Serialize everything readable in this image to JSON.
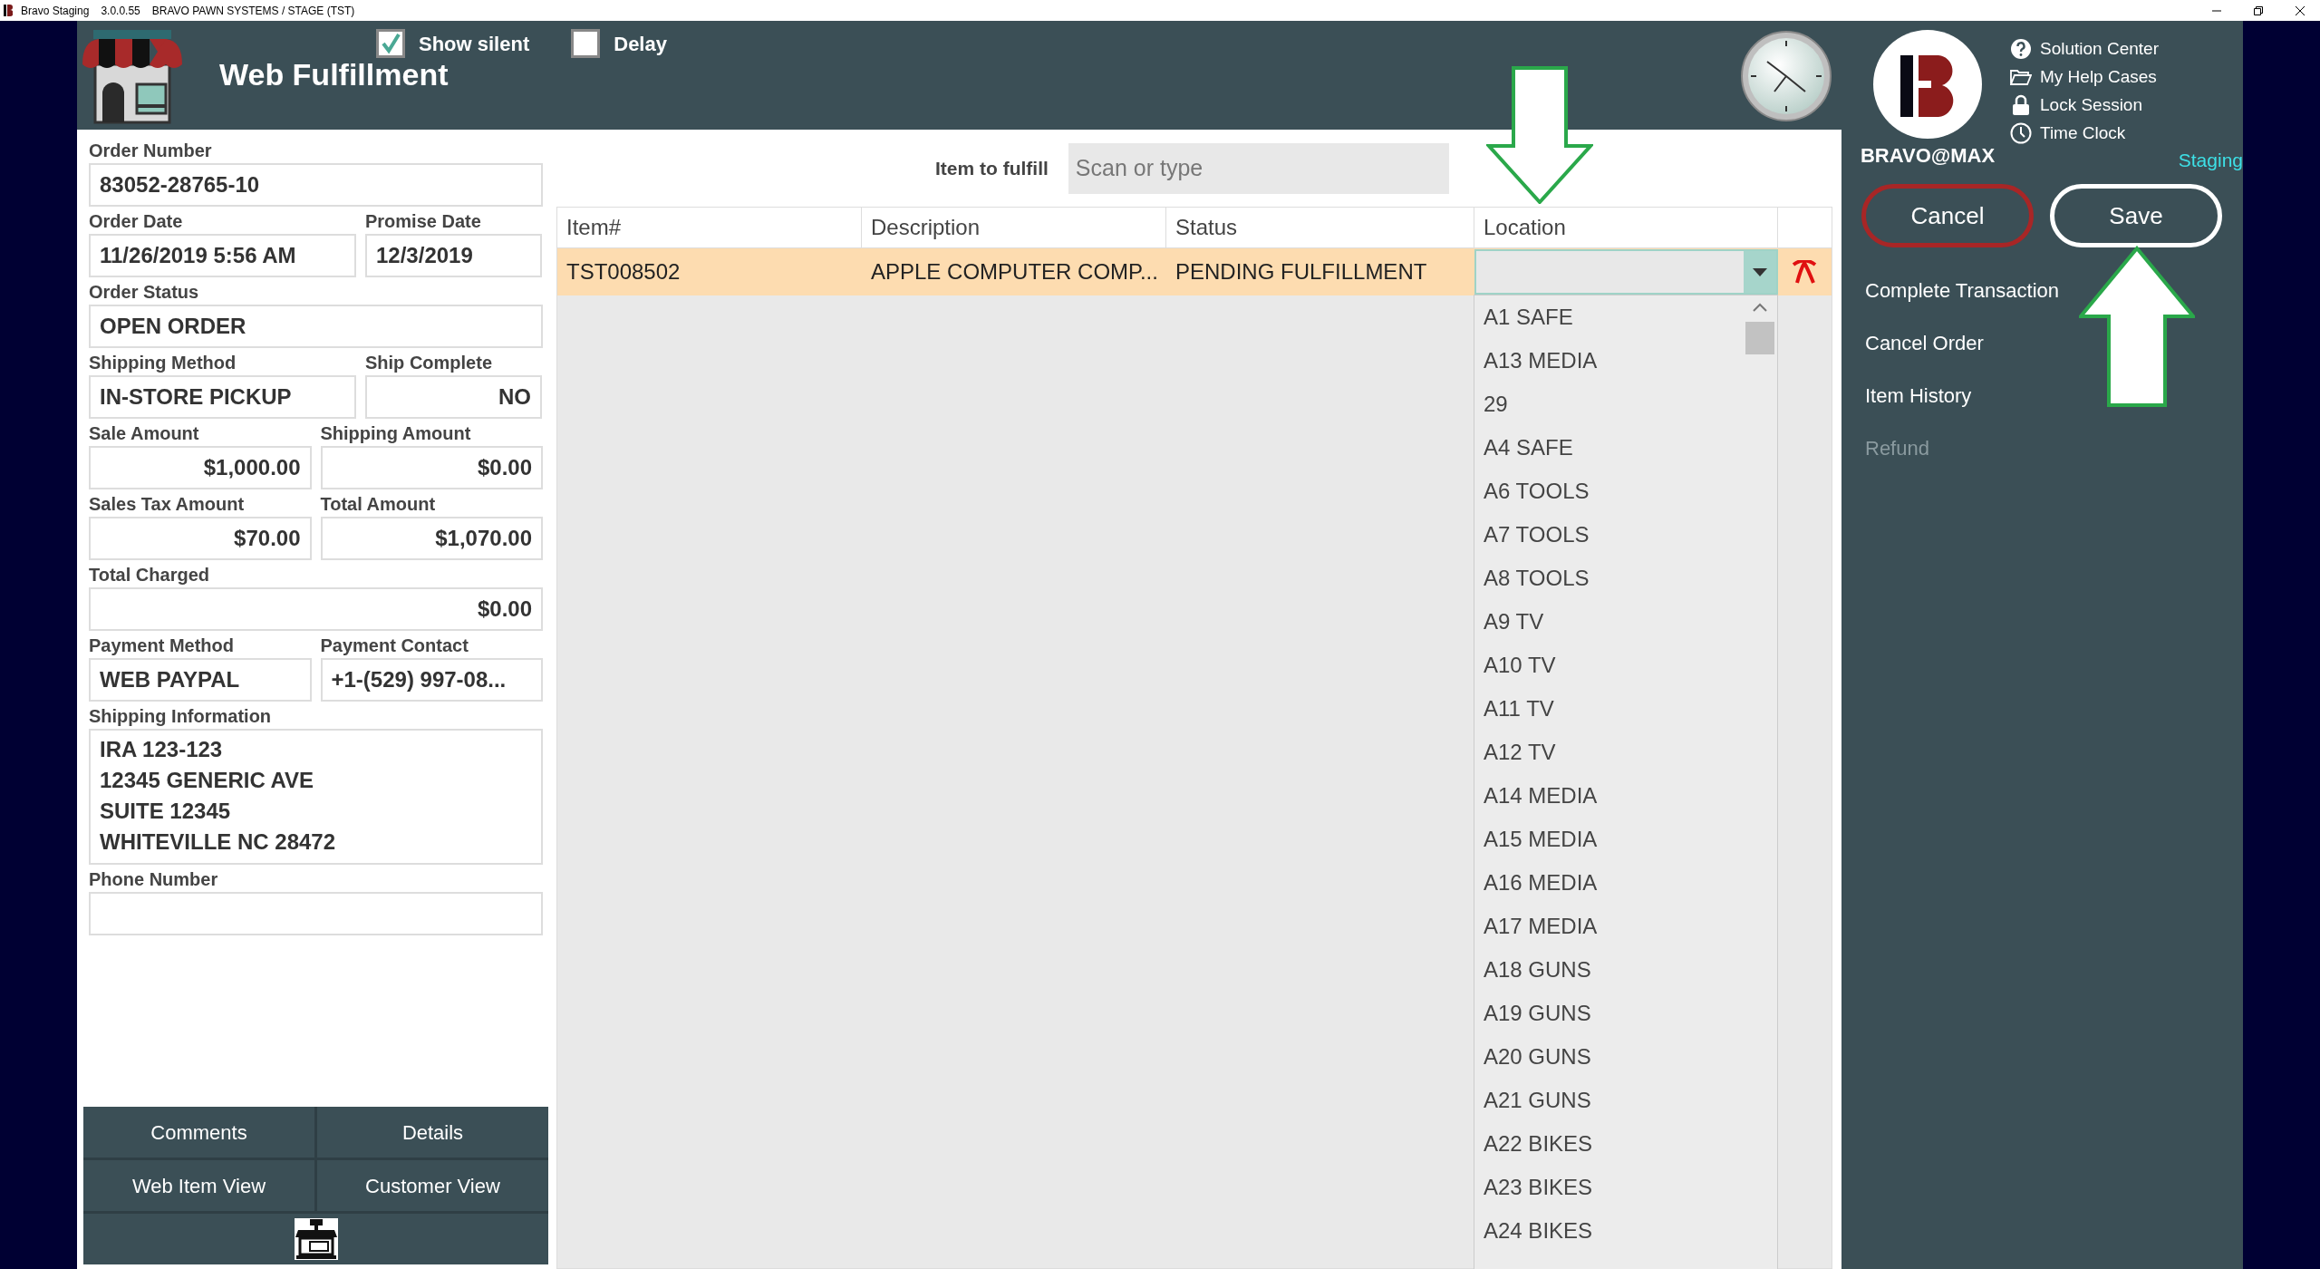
{
  "title_bar": {
    "app_name": "Bravo Staging",
    "version": "3.0.0.55",
    "system": "BRAVO PAWN SYSTEMS / STAGE (TST)"
  },
  "header": {
    "title": "Web Fulfillment",
    "options": [
      {
        "label": "Show silent",
        "checked": true
      },
      {
        "label": "Delay",
        "checked": false
      }
    ]
  },
  "order_form": {
    "rows": [
      [
        {
          "label": "Order Number",
          "value": "83052-28765-10",
          "kind": "text"
        }
      ],
      [
        {
          "label": "Order Date",
          "value": "11/26/2019 5:56 AM",
          "kind": "text"
        },
        {
          "label": "Promise Date",
          "value": "12/3/2019",
          "kind": "text"
        }
      ],
      [
        {
          "label": "Order Status",
          "value": "OPEN ORDER",
          "kind": "text"
        }
      ],
      [
        {
          "label": "Shipping Method",
          "value": "IN-STORE PICKUP",
          "kind": "text"
        },
        {
          "label": "Ship Complete",
          "value": "NO",
          "kind": "number"
        }
      ],
      [
        {
          "label": "Sale Amount",
          "value": "$1,000.00",
          "kind": "number"
        },
        {
          "label": "Shipping Amount",
          "value": "$0.00",
          "kind": "number"
        }
      ],
      [
        {
          "label": "Sales Tax Amount",
          "value": "$70.00",
          "kind": "number"
        },
        {
          "label": "Total Amount",
          "value": "$1,070.00",
          "kind": "number"
        }
      ],
      [
        {
          "label": "Total Charged",
          "value": "$0.00",
          "kind": "number"
        }
      ],
      [
        {
          "label": "Payment Method",
          "value": "WEB PAYPAL",
          "kind": "text"
        },
        {
          "label": "Payment Contact",
          "value": "+1-(529) 997-08...",
          "kind": "text"
        }
      ],
      [
        {
          "label": "Shipping Information",
          "lines": [
            "IRA 123-123",
            "12345 GENERIC AVE",
            "SUITE 12345",
            "WHITEVILLE NC 28472"
          ],
          "kind": "multiline"
        }
      ],
      [
        {
          "label": "Phone Number",
          "kind": "text"
        }
      ]
    ]
  },
  "bottom_buttons": [
    "Comments",
    "Details",
    "Web Item View",
    "Customer View"
  ],
  "item_to_fulfill": {
    "label": "Item to fulfill",
    "placeholder": "Scan or type"
  },
  "table": {
    "columns": [
      "Item#",
      "Description",
      "Status",
      "Location"
    ],
    "rows": [
      {
        "cells": [
          "TST008502",
          "APPLE COMPUTER COMP...",
          "PENDING FULFILLMENT"
        ],
        "selected": true
      }
    ]
  },
  "location_dropdown": {
    "expanded": true,
    "options": [
      "A1 SAFE",
      "A13 MEDIA",
      "29",
      "A4 SAFE",
      "A6 TOOLS",
      "A7 TOOLS",
      "A8 TOOLS",
      "A9 TV",
      "A10 TV",
      "A11 TV",
      "A12 TV",
      "A14 MEDIA",
      "A15 MEDIA",
      "A16 MEDIA",
      "A17 MEDIA",
      "A18 GUNS",
      "A19 GUNS",
      "A20 GUNS",
      "A21 GUNS",
      "A22 BIKES",
      "A23 BIKES",
      "A24 BIKES"
    ]
  },
  "right_panel": {
    "brand": "BRAVO@MAX",
    "environment": "Staging",
    "help_links": [
      {
        "label": "Solution Center",
        "kind": "help"
      },
      {
        "label": "My Help Cases",
        "kind": "folder"
      },
      {
        "label": "Lock Session",
        "kind": "lock"
      },
      {
        "label": "Time Clock",
        "kind": "clock"
      }
    ],
    "buttons": [
      {
        "label": "Cancel",
        "kind": "cancel"
      },
      {
        "label": "Save",
        "kind": "save"
      }
    ],
    "actions": [
      {
        "label": "Complete Transaction",
        "disabled": false
      },
      {
        "label": "Cancel Order",
        "disabled": false
      },
      {
        "label": "Item History",
        "disabled": false
      },
      {
        "label": "Refund",
        "disabled": true
      }
    ]
  }
}
